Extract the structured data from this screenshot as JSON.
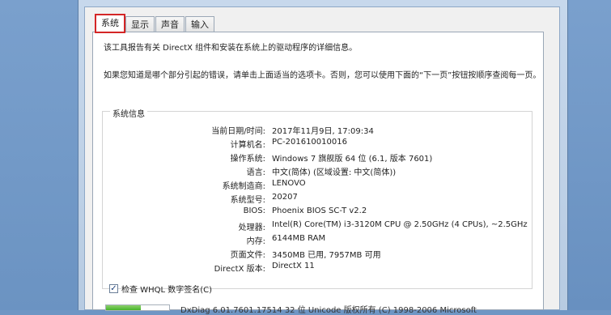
{
  "tabs": [
    "系统",
    "显示",
    "声音",
    "输入"
  ],
  "intro": {
    "line1": "该工具报告有关 DirectX 组件和安装在系统上的驱动程序的详细信息。",
    "line2": "如果您知道是哪个部分引起的错误，请单击上面适当的选项卡。否则，您可以使用下面的“下一页”按钮按顺序查阅每一页。"
  },
  "system_info": {
    "title": "系统信息",
    "rows": [
      {
        "label": "当前日期/时间:",
        "value": "2017年11月9日, 17:09:34"
      },
      {
        "label": "计算机名:",
        "value": "PC-201610010016"
      },
      {
        "label": "操作系统:",
        "value": "Windows 7 旗舰版 64 位 (6.1, 版本 7601)"
      },
      {
        "label": "语言:",
        "value": "中文(简体) (区域设置: 中文(简体))"
      },
      {
        "label": "系统制造商:",
        "value": "LENOVO"
      },
      {
        "label": "系统型号:",
        "value": "20207"
      },
      {
        "label": "BIOS:",
        "value": "Phoenix BIOS SC-T v2.2"
      },
      {
        "label": "处理器:",
        "value": "Intel(R) Core(TM) i3-3120M CPU @ 2.50GHz (4 CPUs), ~2.5GHz"
      },
      {
        "label": "内存:",
        "value": "6144MB RAM"
      },
      {
        "label": "页面文件:",
        "value": "3450MB 已用, 7957MB 可用"
      },
      {
        "label": "DirectX 版本:",
        "value": "DirectX 11"
      }
    ]
  },
  "checkbox": {
    "label": "检查 WHQL 数字签名(C)",
    "checked": true
  },
  "progress": {
    "fraction": 0.55
  },
  "status_text": "DxDiag 6.01.7601.17514 32 位 Unicode 版权所有 (C) 1998-2006 Microsoft"
}
